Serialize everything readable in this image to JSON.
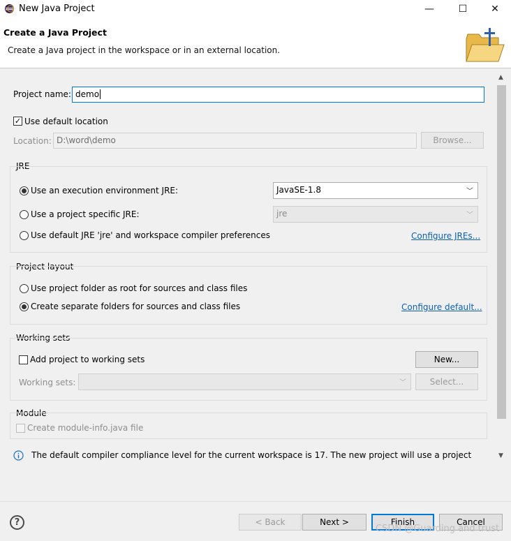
{
  "window": {
    "title": "New Java Project",
    "minimize_glyph": "—",
    "maximize_glyph": "☐",
    "close_glyph": "✕"
  },
  "banner": {
    "heading": "Create a Java Project",
    "description": "Create a Java project in the workspace or in an external location."
  },
  "form": {
    "project_name_label": "Project name:",
    "project_name_value": "demo",
    "use_default_location_label": "Use default location",
    "use_default_location_checked": true,
    "location_label": "Location:",
    "location_value": "D:\\word\\demo",
    "browse_label": "Browse..."
  },
  "jre": {
    "group_label": "JRE",
    "option_execution_env": "Use an execution environment JRE:",
    "execution_env_value": "JavaSE-1.8",
    "option_project_specific": "Use a project specific JRE:",
    "project_specific_value": "jre",
    "option_default": "Use default JRE 'jre' and workspace compiler preferences",
    "configure_jres_link": "Configure JREs...",
    "selected": "execution_env"
  },
  "layout": {
    "group_label": "Project layout",
    "option_root": "Use project folder as root for sources and class files",
    "option_separate": "Create separate folders for sources and class files",
    "configure_default_link": "Configure default...",
    "selected": "separate"
  },
  "working_sets": {
    "group_label": "Working sets",
    "add_label": "Add project to working sets",
    "new_button": "New...",
    "sets_label": "Working sets:",
    "select_button": "Select..."
  },
  "module": {
    "group_label": "Module",
    "create_module_info_label": "Create module-info.java file"
  },
  "info": {
    "icon": "info-icon",
    "message": "The default compiler compliance level for the current workspace is 17. The new project will use a project"
  },
  "footer": {
    "help_glyph": "?",
    "back_label": "< Back",
    "next_label": "Next >",
    "finish_label": "Finish",
    "cancel_label": "Cancel",
    "watermark": "CSDN @Guarding and trust"
  },
  "colors": {
    "accent": "#0078d7",
    "link": "#0b5fb5",
    "panel_bg": "#f0f0f0"
  }
}
